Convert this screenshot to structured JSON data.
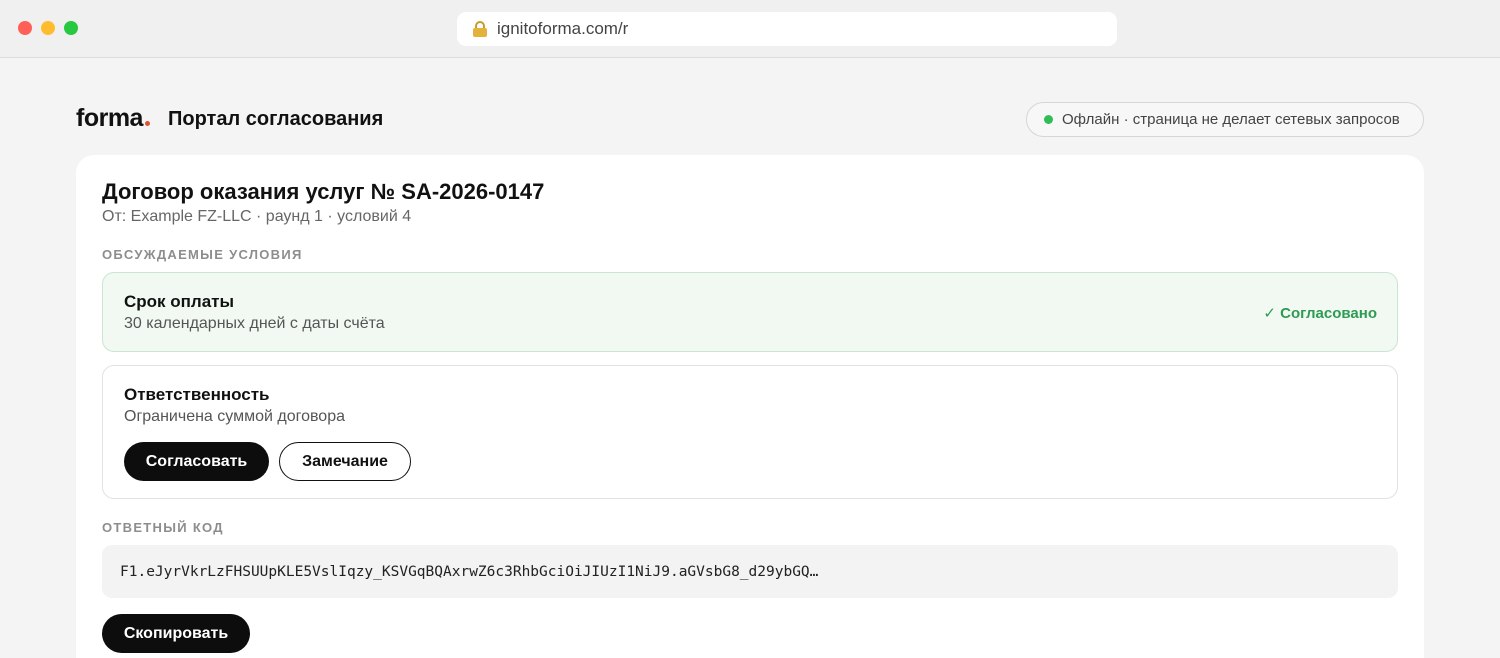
{
  "browser": {
    "url": "ignitoforma.com/r"
  },
  "header": {
    "brand": "forma",
    "portal_title": "Портал согласования",
    "status": "Офлайн · страница не делает сетевых запросов"
  },
  "document": {
    "title": "Договор оказания услуг № SA-2026-0147",
    "subtitle": "От: Example FZ-LLC · раунд 1 · условий 4"
  },
  "terms_section": {
    "label": "ОБСУЖДАЕМЫЕ УСЛОВИЯ",
    "items": [
      {
        "title": "Срок оплаты",
        "description": "30 календарных дней с даты счёта",
        "status": "✓ Согласовано"
      },
      {
        "title": "Ответственность",
        "description": "Ограничена суммой договора",
        "approve_label": "Согласовать",
        "comment_label": "Замечание"
      }
    ]
  },
  "response_section": {
    "label": "ОТВЕТНЫЙ КОД",
    "code": "F1.eJyrVkrLzFHSUUpKLE5VslIqzy_KSVGqBQAxrwZ6c3RhbGciOiJIUzI1NiJ9.aGVsbG8_d29ybGQ…",
    "copy_label": "Скопировать"
  },
  "colors": {
    "accent": "#0d0d0d",
    "agreed_green": "#2e9b52",
    "status_dot": "#2ebd59",
    "brand_dot": "#e0533a"
  }
}
